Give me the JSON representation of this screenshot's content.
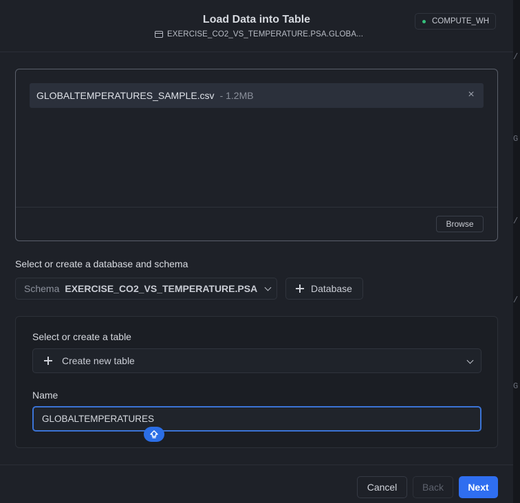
{
  "header": {
    "title": "Load Data into Table",
    "path": "EXERCISE_CO2_VS_TEMPERATURE.PSA.GLOBA...",
    "warehouse": "COMPUTE_WH",
    "warehouse_status_color": "#35c07c"
  },
  "upload": {
    "file_name": "GLOBALTEMPERATURES_SAMPLE.csv",
    "file_size": "- 1.2MB",
    "remove_icon": "close-icon",
    "browse_label": "Browse"
  },
  "db_section": {
    "label": "Select or create a database and schema",
    "schema_key": "Schema",
    "schema_value": "EXERCISE_CO2_VS_TEMPERATURE.PSA",
    "database_label": "Database"
  },
  "table_section": {
    "label": "Select or create a table",
    "table_select": "Create new table",
    "name_label": "Name",
    "name_value": "GLOBALTEMPERATURES"
  },
  "footer": {
    "cancel": "Cancel",
    "back": "Back",
    "next": "Next",
    "primary_color": "#2f6ef0"
  }
}
